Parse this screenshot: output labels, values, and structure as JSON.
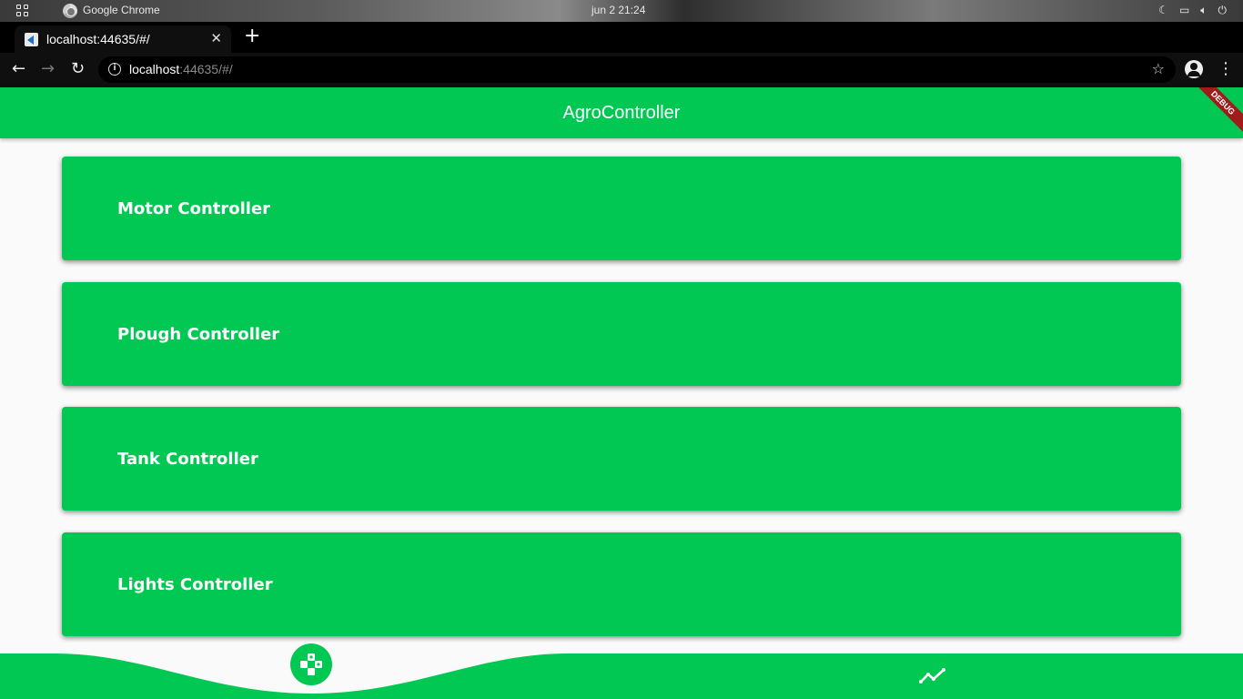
{
  "os": {
    "app_name": "Google Chrome",
    "clock": "jun 2  21:24"
  },
  "browser": {
    "tab_title": "localhost:44635/#/",
    "url_host": "localhost",
    "url_rest": ":44635/#/"
  },
  "app": {
    "title": "AgroController",
    "debug_banner": "DEBUG",
    "accent_color": "#00c853"
  },
  "controllers": [
    {
      "label": "Motor Controller"
    },
    {
      "label": "Plough Controller"
    },
    {
      "label": "Tank Controller"
    },
    {
      "label": "Lights Controller"
    }
  ],
  "bottom_nav": {
    "items": [
      {
        "icon": "gamepad-icon",
        "active": true
      },
      {
        "icon": "chart-line-icon",
        "active": false
      }
    ]
  }
}
